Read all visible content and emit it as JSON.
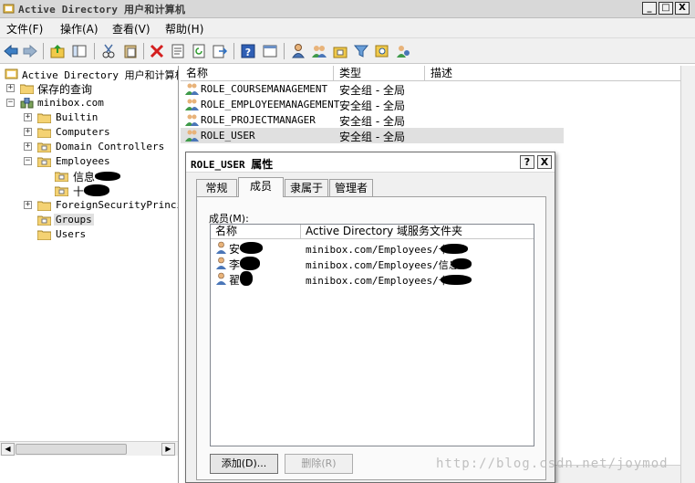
{
  "window": {
    "title": "Active Directory 用户和计算机",
    "min": "_",
    "max": "□",
    "close": "X"
  },
  "menu": [
    "文件(F)",
    "操作(A)",
    "查看(V)",
    "帮助(H)"
  ],
  "tree": {
    "root": "Active Directory 用户和计算机",
    "saved_queries": "保存的查询",
    "domain": "minibox.com",
    "builtin": "Builtin",
    "computers": "Computers",
    "domain_controllers": "Domain Controllers",
    "employees": "Employees",
    "sub1": "信息",
    "sub2": "十",
    "foreign": "ForeignSecurityPrincip",
    "groups": "Groups",
    "users": "Users"
  },
  "list": {
    "columns": [
      "名称",
      "类型",
      "描述"
    ],
    "rows": [
      {
        "name": "ROLE_COURSEMANAGEMENT",
        "type": "安全组 - 全局"
      },
      {
        "name": "ROLE_EMPLOYEEMANAGEMENT",
        "type": "安全组 - 全局"
      },
      {
        "name": "ROLE_PROJECTMANAGER",
        "type": "安全组 - 全局"
      },
      {
        "name": "ROLE_USER",
        "type": "安全组 - 全局"
      }
    ]
  },
  "dialog": {
    "title_name": "ROLE_USER",
    "title_suffix": "属性",
    "help": "?",
    "close": "X",
    "tabs": [
      "常规",
      "成员",
      "隶属于",
      "管理者"
    ],
    "members_label": "成员(M):",
    "columns": [
      "名称",
      "Active Directory 域服务文件夹"
    ],
    "members": [
      {
        "name": "安",
        "path": "minibox.com/Employees/十"
      },
      {
        "name": "李",
        "path": "minibox.com/Employees/信息"
      },
      {
        "name": "翟",
        "path": "minibox.com/Employees/十"
      }
    ],
    "add_button": "添加(D)...",
    "remove_button": "删除(R)"
  },
  "watermark": "http://blog.csdn.net/joymod",
  "scroll": {
    "left": "◀",
    "right": "▶"
  }
}
